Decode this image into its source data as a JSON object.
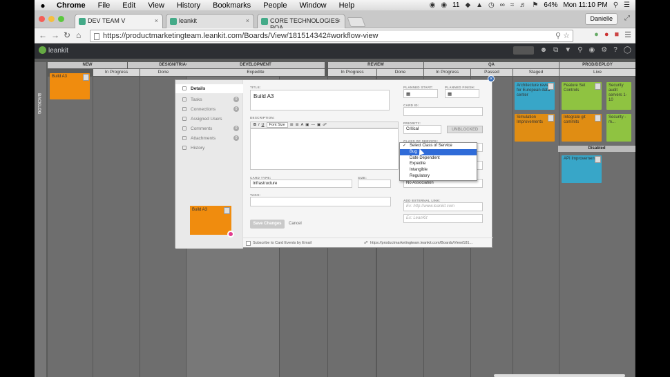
{
  "menubar": {
    "apple": "",
    "items": [
      "Chrome",
      "File",
      "Edit",
      "View",
      "History",
      "Bookmarks",
      "People",
      "Window",
      "Help"
    ],
    "status": {
      "badge": "11",
      "battery": "64%",
      "clock": "Mon 11:10 PM"
    }
  },
  "browser": {
    "tabs": [
      {
        "label": "DEV TEAM V",
        "active": true
      },
      {
        "label": "leankit",
        "active": false
      },
      {
        "label": "CORE TECHNOLOGIES BOA",
        "active": false
      }
    ],
    "user": "Danielle",
    "url": "https://productmarketingteam.leankit.com/Boards/View/181514342#workflow-view"
  },
  "app": {
    "logo": "leankit"
  },
  "board": {
    "backlog_label": "BACKLOG",
    "groups": [
      {
        "name": "NEW"
      },
      {
        "name": "DESIGN/TRIAGE"
      },
      {
        "name": "DEVELOPMENT"
      },
      {
        "name": "REVIEW"
      },
      {
        "name": "QA"
      },
      {
        "name": "PROD/DEPLOY"
      }
    ],
    "subcolumns": [
      "In Progress",
      "Done",
      "Expedite",
      "In Progress",
      "Done",
      "In Progress",
      "Passed",
      "Staged",
      "Live"
    ],
    "cards": [
      {
        "title": "Build A3"
      },
      {
        "title": "Architecture review for European data center"
      },
      {
        "title": "Feature Set Controls"
      },
      {
        "title": "Security audit servers 1-10"
      },
      {
        "title": "Simulation Improvements"
      },
      {
        "title": "Integrate git commits"
      },
      {
        "title": "Security - m..."
      },
      {
        "title": "API Improvements"
      }
    ],
    "disabled_label": "Disabled"
  },
  "modal": {
    "nav": [
      {
        "label": "Details"
      },
      {
        "label": "Tasks",
        "badge": "0"
      },
      {
        "label": "Connections",
        "badge": "0"
      },
      {
        "label": "Assigned Users"
      },
      {
        "label": "Comments",
        "badge": "0"
      },
      {
        "label": "Attachments",
        "badge": "0"
      },
      {
        "label": "History"
      }
    ],
    "preview_title": "Build A3",
    "title_label": "TITLE:",
    "title_value": "Build A3",
    "description_label": "DESCRIPTION:",
    "rte_font": "Font Size",
    "card_type_label": "CARD TYPE:",
    "card_type_value": "Infrastructure",
    "size_label": "SIZE:",
    "tags_label": "TAGS:",
    "planned_start_label": "PLANNED START:",
    "planned_finish_label": "PLANNED FINISH:",
    "card_id_label": "CARD ID:",
    "priority_label": "PRIORITY:",
    "priority_value": "Critical",
    "unblocked": "UNBLOCKED",
    "class_label": "CLASS OF SERVICE:",
    "association_value": "No Association",
    "ext_link_label": "ADD EXTERNAL LINK:",
    "ext_link_placeholder": "Ex: http://www.leankit.com",
    "ext_link_placeholder2": "Ex: LeanKit",
    "save": "Save Changes",
    "cancel": "Cancel",
    "subscribe": "Subscribe to Card Events by Email",
    "card_link": "https://productmarketingteam.leankit.com/Boards/View/181...",
    "class_options": [
      "Select Class of Service",
      "Bug",
      "Date Dependent",
      "Expedite",
      "Intangible",
      "Regulatory"
    ],
    "class_selected": 1
  },
  "colors": {
    "orange": "#f08c0e",
    "teal": "#38a6c8",
    "green": "#8fc341",
    "amber": "#e08d13"
  }
}
